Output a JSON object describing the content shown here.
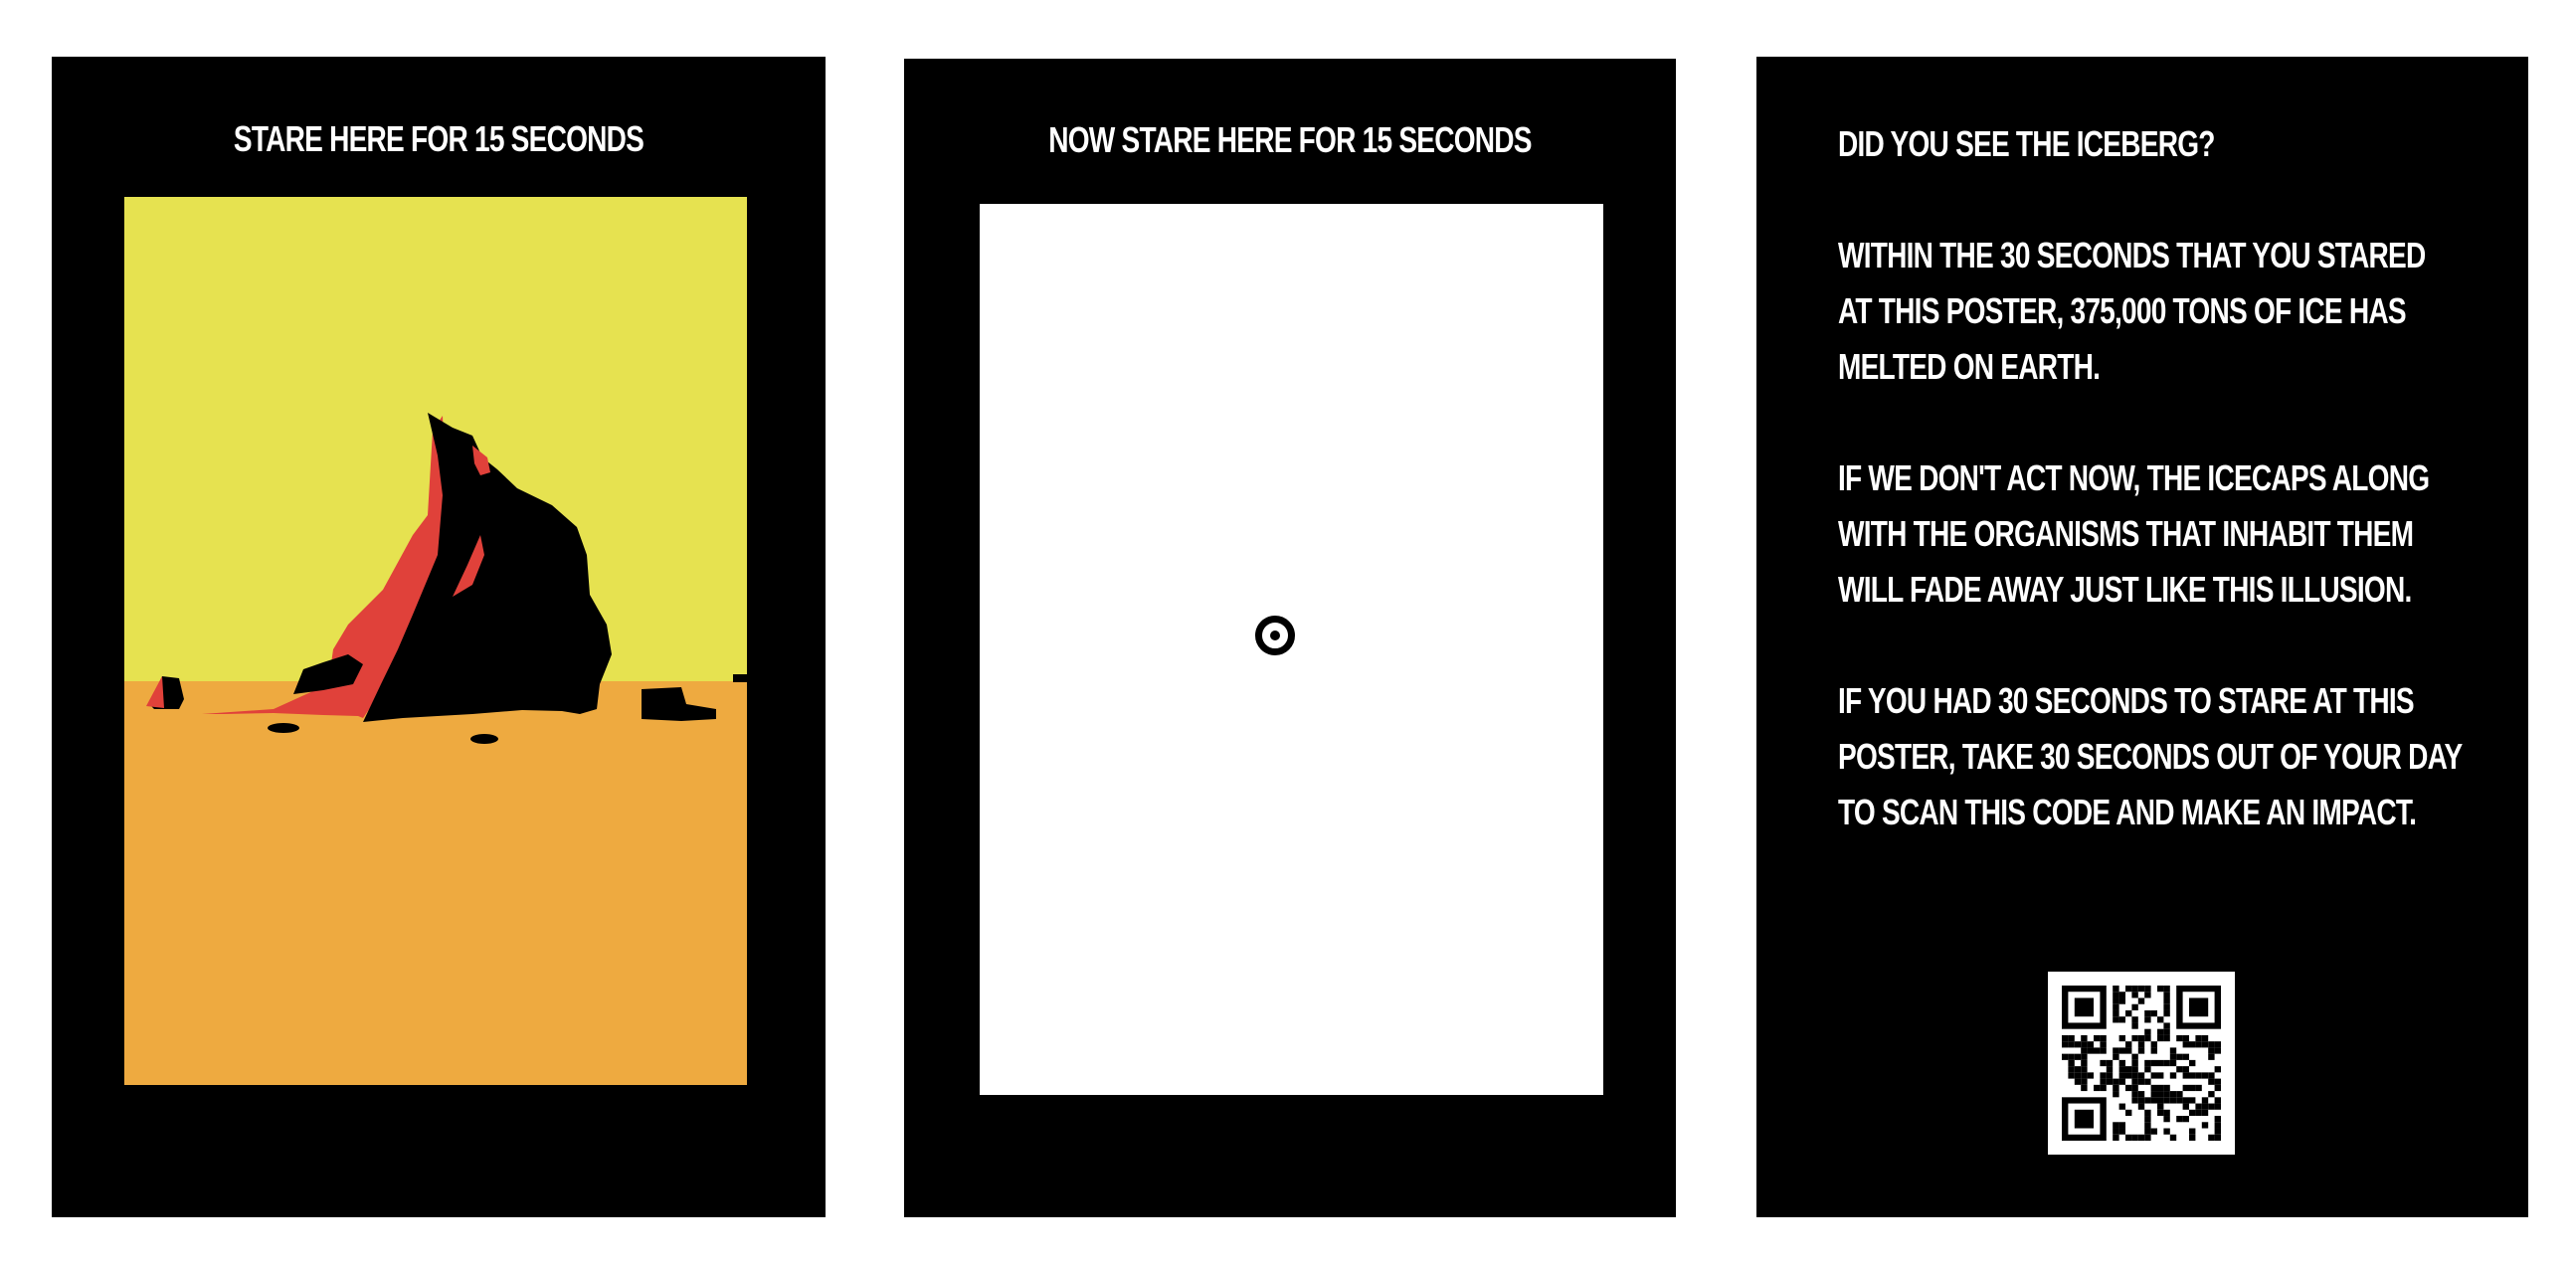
{
  "posters": [
    {
      "heading": "STARE HERE FOR 15 SECONDS",
      "colors": {
        "background": "#000000",
        "sky": "#e6e250",
        "ground": "#eeaa40",
        "iceberg": "#000000",
        "iceberg_shadow": "#e0413a"
      }
    },
    {
      "heading": "NOW STARE HERE FOR 15 SECONDS",
      "colors": {
        "background": "#000000",
        "panel": "#ffffff",
        "focus_dot": "#000000"
      }
    },
    {
      "paragraphs": [
        {
          "lines": [
            "DID YOU SEE THE ICEBERG?"
          ]
        },
        {
          "lines": [
            "WITHIN THE 30 SECONDS THAT YOU STARED",
            "AT THIS POSTER, 375,000 TONS OF ICE HAS",
            "MELTED ON EARTH."
          ]
        },
        {
          "lines": [
            "IF WE DON'T ACT NOW, THE ICECAPS ALONG",
            "WITH THE ORGANISMS THAT INHABIT THEM",
            "WILL FADE AWAY JUST LIKE THIS ILLUSION."
          ]
        },
        {
          "lines": [
            "IF YOU HAD 30 SECONDS TO STARE AT THIS",
            "POSTER, TAKE 30 SECONDS OUT OF YOUR DAY",
            "TO SCAN THIS CODE AND MAKE AN IMPACT."
          ]
        }
      ],
      "qr_icon": "qr-code-icon"
    }
  ]
}
